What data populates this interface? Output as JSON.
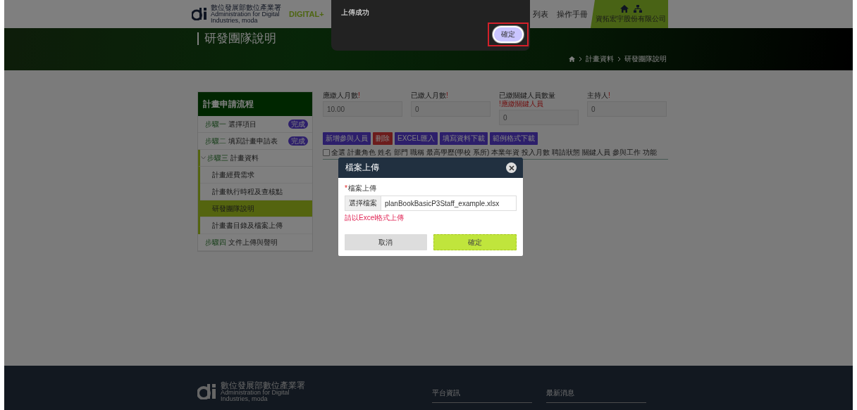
{
  "header": {
    "agency": "數位發展部數位產業署",
    "agency_en": "Administration for Digital Industries, moda",
    "brand": "DIGITAL+",
    "nav": [
      "列表",
      "操作手冊"
    ],
    "company": "資拓宏宇股份有限公司"
  },
  "banner": {
    "title": "研發團隊說明",
    "breadcrumb": [
      "計畫資料",
      "研發團隊說明"
    ]
  },
  "sidebar": {
    "title": "計畫申請流程",
    "items": [
      {
        "step": "步驟一",
        "label": "選擇項目",
        "badge": "完成",
        "expanded": false
      },
      {
        "step": "步驟二",
        "label": "填寫計畫申請表",
        "badge": "完成",
        "expanded": false
      },
      {
        "step": "步驟三",
        "label": "計畫資料",
        "expanded": true,
        "children": [
          {
            "label": "計畫經費需求",
            "selected": false
          },
          {
            "label": "計畫執行時程及查核點",
            "selected": false
          },
          {
            "label": "研發團隊說明",
            "selected": true
          },
          {
            "label": "計畫書目錄及檔案上傳",
            "selected": false
          }
        ]
      },
      {
        "step": "步驟四",
        "label": "文件上傳與聲明",
        "expanded": false
      }
    ]
  },
  "fields": [
    {
      "label": "應繳人月數",
      "mark": "!",
      "value": "10.00"
    },
    {
      "label": "已繳人月數",
      "mark": "!",
      "value": "0"
    },
    {
      "label": "已繳關鍵人員數量",
      "mark": "!應繳關鍵人員",
      "value": "0"
    },
    {
      "label": "主持人",
      "mark": "!",
      "value": "0"
    }
  ],
  "actions": [
    {
      "label": "新增參與人員",
      "kind": "primary"
    },
    {
      "label": "刪除",
      "kind": "danger"
    },
    {
      "label": "EXCEL匯入",
      "kind": "primary"
    },
    {
      "label": "填寫資料下載",
      "kind": "primary"
    },
    {
      "label": "範例格式下載",
      "kind": "primary"
    }
  ],
  "table": {
    "select_all": {
      "label": "全選",
      "checked": false
    },
    "columns": [
      "計畫角色",
      "姓名",
      "部門",
      "職稱",
      "最高學歷(學校 系所)",
      "本業年資",
      "投入月數",
      "聘請狀態",
      "關鍵人員",
      "參與工作",
      "功能"
    ]
  },
  "footer": {
    "agency": "數位發展部數位產業署",
    "agency_en": "Administration for Digital Industries, moda",
    "links": [
      "平台資訊",
      "最新消息"
    ]
  },
  "modal": {
    "title": "檔案上傳",
    "field_label": "檔案上傳",
    "required_mark": "*",
    "file_button": "選擇檔案",
    "file_name": "planBookBasicP3Staff_example.xlsx",
    "error": "請以Excel格式上傳",
    "buttons": [
      {
        "label": "取消",
        "kind": "cancel"
      },
      {
        "label": "確定",
        "kind": "confirm"
      }
    ]
  },
  "toast": {
    "message": "上傳成功",
    "button": "確定",
    "highlighted": true
  }
}
